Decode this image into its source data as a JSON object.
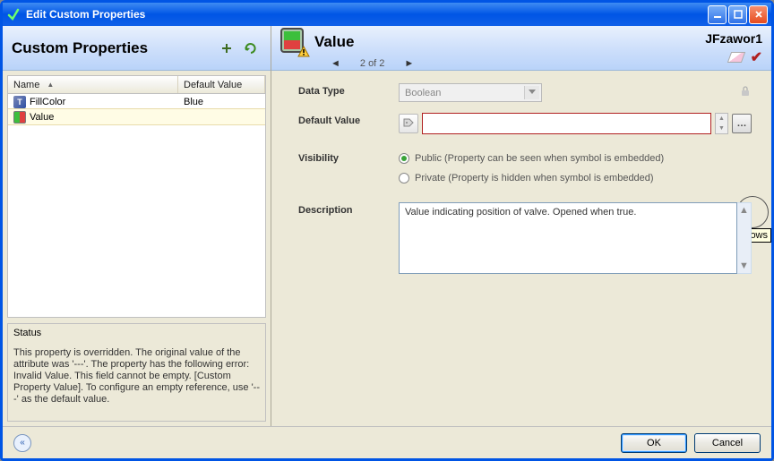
{
  "window": {
    "title": "Edit Custom Properties"
  },
  "left": {
    "heading": "Custom Properties",
    "columns": {
      "name": "Name",
      "default": "Default Value"
    },
    "rows": [
      {
        "icon": "fill",
        "name": "FillColor",
        "default": "Blue",
        "selected": false
      },
      {
        "icon": "valve",
        "name": "Value",
        "default": "",
        "selected": true
      }
    ],
    "status": {
      "title": "Status",
      "body": "This property is overridden.  The original value of the attribute was '---'.  The property has the following error: Invalid Value. This field cannot be empty. [Custom Property Value]. To configure an empty reference, use '---' as the default value."
    }
  },
  "right": {
    "title": "Value",
    "context": "JFzawor1",
    "pager": "2 of 2",
    "fields": {
      "dataType": {
        "label": "Data Type",
        "value": "Boolean"
      },
      "defaultValue": {
        "label": "Default Value",
        "value": ""
      },
      "visibility": {
        "label": "Visibility",
        "public": "Public (Property can be seen when symbol is embedded)",
        "private": "Private (Property is hidden when symbol is embedded)",
        "selected": "public"
      },
      "description": {
        "label": "Description",
        "value": "Value indicating position of valve.  Opened when true."
      }
    },
    "browseTooltip": "Brows"
  },
  "footer": {
    "ok": "OK",
    "cancel": "Cancel"
  }
}
